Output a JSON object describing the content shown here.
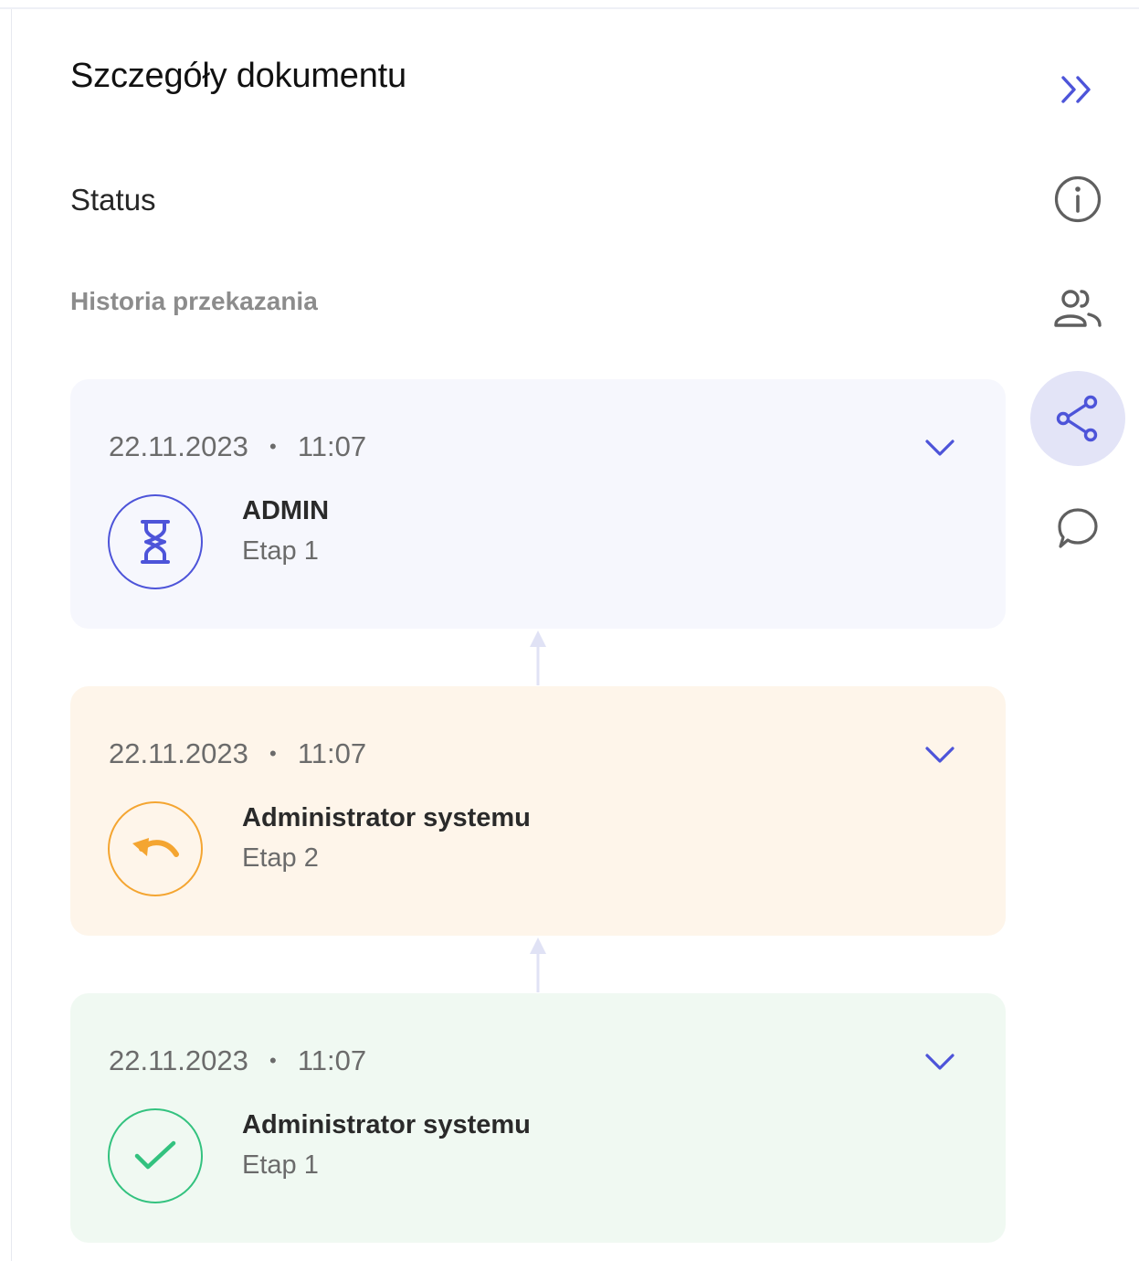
{
  "panel": {
    "title": "Szczegóły dokumentu",
    "status_label": "Status",
    "history_label": "Historia przekazania"
  },
  "sidebar": {
    "items": [
      {
        "icon": "double-chevron-right-icon",
        "active": false
      },
      {
        "icon": "info-icon",
        "active": false
      },
      {
        "icon": "users-icon",
        "active": false
      },
      {
        "icon": "share-icon",
        "active": true
      },
      {
        "icon": "comment-icon",
        "active": false
      }
    ]
  },
  "history": [
    {
      "date": "22.11.2023",
      "separator": "•",
      "time": "11:07",
      "name": "ADMIN",
      "stage": "Etap 1",
      "status_icon": "hourglass-icon",
      "card_color": "#f6f7fd",
      "accent_color": "#4d54d9"
    },
    {
      "date": "22.11.2023",
      "separator": "•",
      "time": "11:07",
      "name": "Administrator systemu",
      "stage": "Etap 2",
      "status_icon": "return-arrow-icon",
      "card_color": "#fef5ea",
      "accent_color": "#f4a531"
    },
    {
      "date": "22.11.2023",
      "separator": "•",
      "time": "11:07",
      "name": "Administrator systemu",
      "stage": "Etap 1",
      "status_icon": "check-icon",
      "card_color": "#f0f9f2",
      "accent_color": "#33c27f"
    }
  ],
  "colors": {
    "accent": "#4d54d9",
    "connector": "#e0e2f5",
    "icon_gray": "#5f5f5f"
  }
}
